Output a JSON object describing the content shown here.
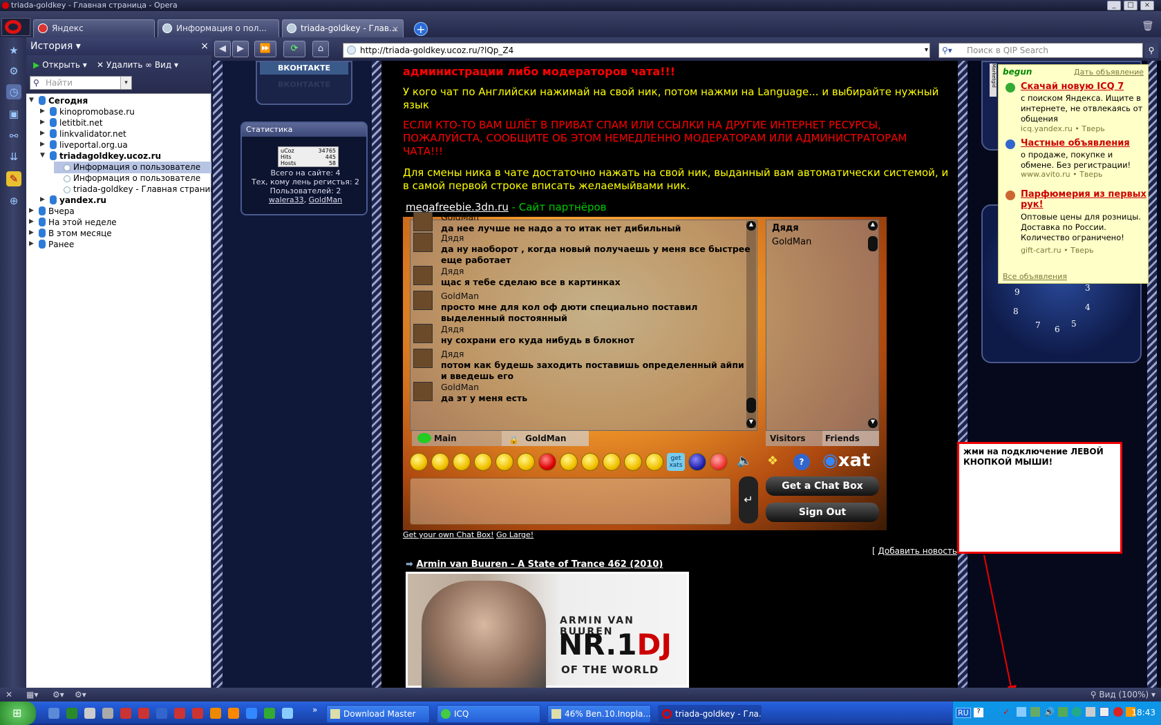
{
  "window": {
    "title": "triada-goldkey - Главная страница - Opera"
  },
  "tabs": [
    {
      "label": "Яндекс",
      "active": false
    },
    {
      "label": "Информация о пол...",
      "active": false
    },
    {
      "label": "triada-goldkey - Глав...",
      "active": true
    }
  ],
  "history": {
    "title": "История",
    "open_label": "Открыть",
    "delete_label": "Удалить",
    "view_label": "Вид",
    "search_placeholder": "Найти",
    "tree": [
      {
        "label": "Сегодня",
        "bold": true,
        "level": 0
      },
      {
        "label": "kinopromobase.ru",
        "level": 1
      },
      {
        "label": "letitbit.net",
        "level": 1
      },
      {
        "label": "linkvalidator.net",
        "level": 1
      },
      {
        "label": "liveportal.org.ua",
        "level": 1
      },
      {
        "label": "triadagoldkey.ucoz.ru",
        "bold": true,
        "level": 1
      },
      {
        "label": "Информация о пользователе",
        "level": 2,
        "selected": true
      },
      {
        "label": "Информация о пользователе",
        "level": 2
      },
      {
        "label": "triada-goldkey - Главная страница",
        "level": 2
      },
      {
        "label": "yandex.ru",
        "bold": true,
        "level": 1
      },
      {
        "label": "Вчера",
        "level": 0
      },
      {
        "label": "На этой неделе",
        "level": 0
      },
      {
        "label": "В этом месяце",
        "level": 0
      },
      {
        "label": "Ранее",
        "level": 0
      }
    ]
  },
  "address": {
    "url": "http://triada-goldkey.ucoz.ru/?lQp_Z4",
    "search_placeholder": "Поиск в QIP Search"
  },
  "page": {
    "red1": "администрации либо модераторов чата!!!",
    "yellow1": "У кого чат по Английски нажимай на свой ник, потом нажми на Language... и выбирайте нужный язык",
    "red2": "ЕСЛИ КТО-ТО ВАМ ШЛЁТ В ПРИВАТ СПАМ ИЛИ ССЫЛКИ НА ДРУГИЕ ИНТЕРНЕТ РЕСУРСЫ, ПОЖАЛУЙСТА, СООБЩИТЕ ОБ ЭТОМ НЕМЕДЛЕННО МОДЕРАТОРАМ ИЛИ АДМИНИСТРАТОРАМ ЧАТА!!!",
    "yellow2": "Для смены ника в чате достаточно нажать на свой ник, выданный вам автоматически системой, и в самой первой строке вписать желаемыйвами ник.",
    "partner_link": "megafreebie.3dn.ru",
    "partner_sep": " - ",
    "partner_label": "Сайт партнёров",
    "get_chat_link": "Get your own Chat Box!",
    "go_large_link": "Go Large!",
    "add_news": "Добавить новость",
    "news_title": "Armin van Buuren - A State of Trance 462 (2010)",
    "album_artist": "ARMIN VAN BUUREN",
    "album_nr": "NR.1",
    "album_dj": "DJ",
    "album_sub": "OF THE WORLD",
    "vkontakte": "ВКОНТАКТЕ"
  },
  "stats": {
    "title": "Статистика",
    "counter_label": "uCoz",
    "counter_value": "34765",
    "hits_label": "Hits",
    "hits_value": "445",
    "hosts_label": "Hosts",
    "hosts_value": "58",
    "total_online": "Всего на сайте: 4",
    "guests": "Тех, кому лень регистья: 2",
    "users": "Пользователей: 2",
    "user1": "walera33",
    "user_sep": ", ",
    "user2": "GoldMan"
  },
  "chat": {
    "messages": [
      {
        "name": "GoldMan",
        "text": "да нее лучше не надо а то итак нет дибильный"
      },
      {
        "name": "Дядя",
        "text": "да ну наоборот , когда новый получаешь у меня все быстрее еще работает"
      },
      {
        "name": "Дядя",
        "text": "щас я тебе сделаю все в картинках"
      },
      {
        "name": "GoldMan",
        "text": "просто мне для кол оф дюти специально поставил выделенный постоянный"
      },
      {
        "name": "Дядя",
        "text": "ну сохрани его куда нибудь в блокнот"
      },
      {
        "name": "Дядя",
        "text": "потом как будешь заходить поставишь определенный айпи и введешь его"
      },
      {
        "name": "GoldMan",
        "text": "да эт у меня есть"
      }
    ],
    "visitors": [
      "Дядя",
      "GoldMan"
    ],
    "tab_main": "Main",
    "tab_private": "GoldMan",
    "tab_visitors": "Visitors",
    "tab_friends": "Friends",
    "getx_label": "get xats",
    "brand": "xat",
    "get_chat_box": "Get a Chat Box",
    "sign_out": "Sign Out"
  },
  "ad": {
    "brand": "begun",
    "place_ad": "Дать объявление",
    "items": [
      {
        "title": "Скачай новую ICQ 7",
        "desc": "с поиском Яндекса. Ищите в интернете, не отвлекаясь от общения",
        "url": "icq.yandex.ru",
        "city": "Тверь"
      },
      {
        "title": "Частные объявления",
        "desc": "о продаже, покупке и обмене. Без регистрации!",
        "url": "www.avito.ru",
        "city": "Тверь"
      },
      {
        "title": "Парфюмерия из первых рук!",
        "desc": "Оптовые цены для розницы. Доставка по России. Количество ограничено!",
        "url": "gift-cart.ru",
        "city": "Тверь"
      }
    ],
    "all_ads": "Все объявления",
    "side_label": "Marketgid"
  },
  "note": {
    "text": "жми на подключение ЛЕВОЙ КНОПКОЙ МЫШИ!"
  },
  "clock_numbers": [
    "3",
    "4",
    "5",
    "6",
    "7",
    "8",
    "9"
  ],
  "statusbar": {
    "zoom": "Вид (100%)"
  },
  "taskbar": {
    "items": [
      {
        "label": "Download Master"
      },
      {
        "label": "ICQ"
      },
      {
        "label": "46% Ben.10.Inopla..."
      },
      {
        "label": "triada-goldkey - Гла..."
      }
    ],
    "lang": "RU",
    "time": "18:43"
  },
  "colors": {
    "accent_red": "#ff0000",
    "accent_yellow": "#ffff00",
    "opera_red": "#e01010"
  }
}
